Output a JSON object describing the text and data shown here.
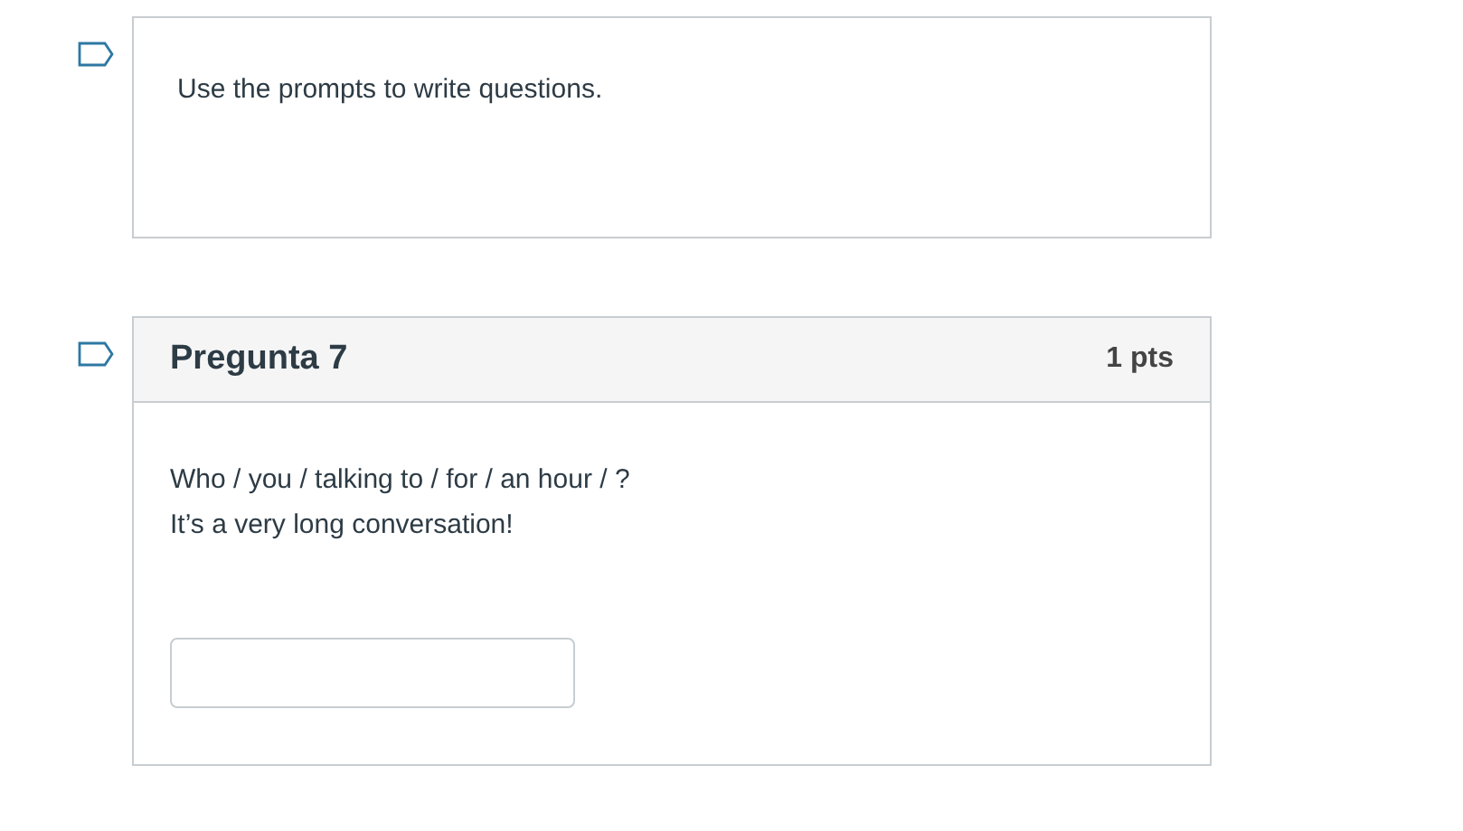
{
  "items": [
    {
      "kind": "text",
      "flagged": false,
      "text": "Use the prompts to write questions."
    },
    {
      "kind": "question",
      "flagged": false,
      "title": "Pregunta 7",
      "points": "1 pts",
      "lines": [
        "Who / you / talking to / for / an hour / ?",
        "It’s a very long conversation!"
      ]
    }
  ]
}
